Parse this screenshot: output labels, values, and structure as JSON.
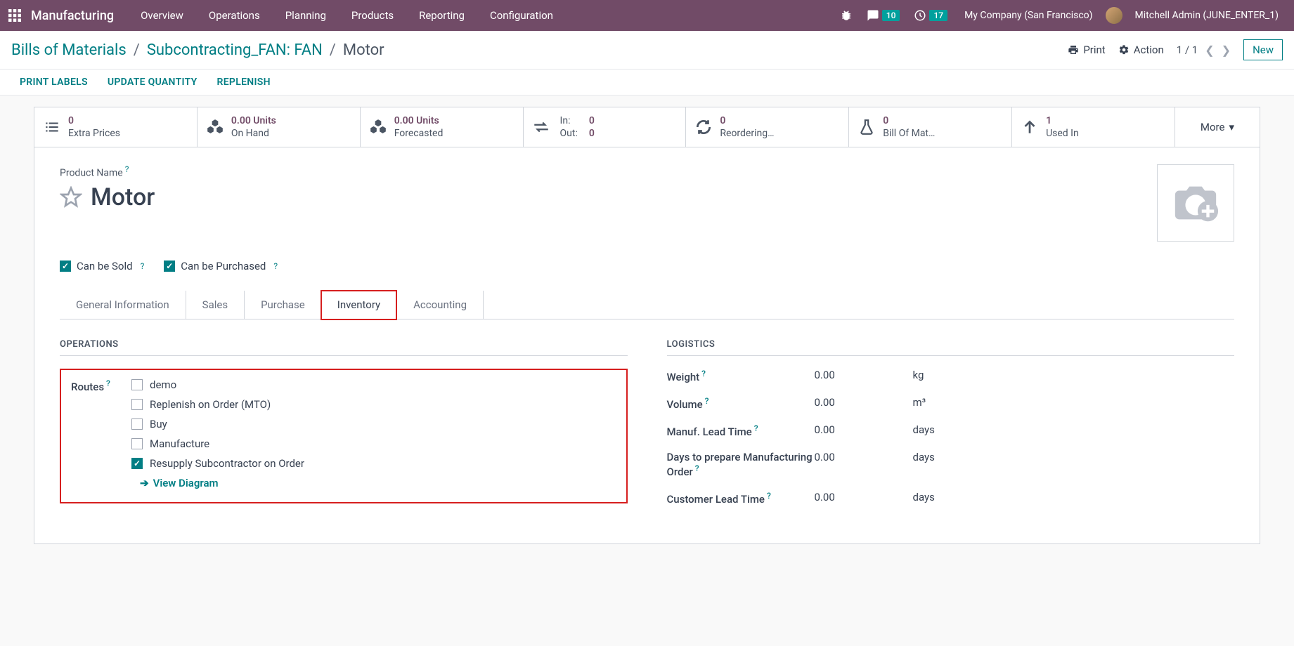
{
  "nav": {
    "app": "Manufacturing",
    "items": [
      "Overview",
      "Operations",
      "Planning",
      "Products",
      "Reporting",
      "Configuration"
    ],
    "messages_badge": "10",
    "activities_badge": "17",
    "company": "My Company (San Francisco)",
    "user": "Mitchell Admin (JUNE_ENTER_1)"
  },
  "breadcrumb": {
    "root": "Bills of Materials",
    "parent": "Subcontracting_FAN: FAN",
    "current": "Motor"
  },
  "header": {
    "print": "Print",
    "action": "Action",
    "pager": "1 / 1",
    "new": "New"
  },
  "action_bar": {
    "print_labels": "PRINT LABELS",
    "update_qty": "UPDATE QUANTITY",
    "replenish": "REPLENISH"
  },
  "stats": {
    "extra_prices": {
      "val": "0",
      "label": "Extra Prices"
    },
    "on_hand": {
      "val": "0.00 Units",
      "label": "On Hand"
    },
    "forecasted": {
      "val": "0.00 Units",
      "label": "Forecasted"
    },
    "in": {
      "label": "In:",
      "val": "0"
    },
    "out": {
      "label": "Out:",
      "val": "0"
    },
    "reordering": {
      "val": "0",
      "label": "Reordering…"
    },
    "bom": {
      "val": "0",
      "label": "Bill Of Mat…"
    },
    "used_in": {
      "val": "1",
      "label": "Used In"
    },
    "more": "More"
  },
  "form": {
    "product_name_label": "Product Name",
    "product_name": "Motor",
    "can_be_sold": "Can be Sold",
    "can_be_purchased": "Can be Purchased"
  },
  "tabs": [
    "General Information",
    "Sales",
    "Purchase",
    "Inventory",
    "Accounting"
  ],
  "operations": {
    "title": "OPERATIONS",
    "routes_label": "Routes",
    "routes": [
      {
        "label": "demo",
        "checked": false
      },
      {
        "label": "Replenish on Order (MTO)",
        "checked": false
      },
      {
        "label": "Buy",
        "checked": false
      },
      {
        "label": "Manufacture",
        "checked": false
      },
      {
        "label": "Resupply Subcontractor on Order",
        "checked": true
      }
    ],
    "view_diagram": "View Diagram"
  },
  "logistics": {
    "title": "LOGISTICS",
    "rows": [
      {
        "label": "Weight",
        "val": "0.00",
        "unit": "kg",
        "help": true
      },
      {
        "label": "Volume",
        "val": "0.00",
        "unit": "m³",
        "help": true
      },
      {
        "label": "Manuf. Lead Time",
        "val": "0.00",
        "unit": "days",
        "help": true
      },
      {
        "label": "Days to prepare Manufacturing Order",
        "val": "0.00",
        "unit": "days",
        "help": true
      },
      {
        "label": "Customer Lead Time",
        "val": "0.00",
        "unit": "days",
        "help": true
      }
    ]
  }
}
